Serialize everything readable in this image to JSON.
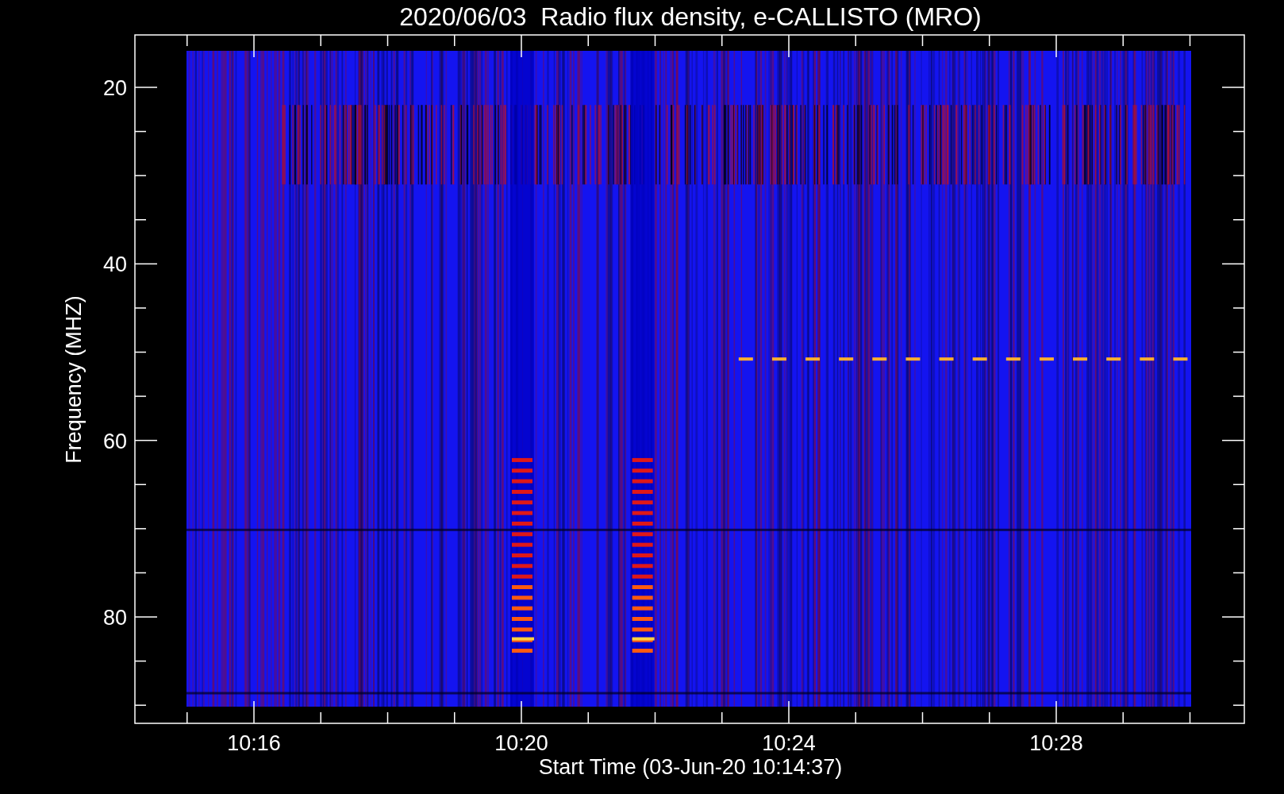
{
  "title": "2020/06/03  Radio flux density, e-CALLISTO (MRO)",
  "y_axis": {
    "label": "Frequency (MHZ)",
    "tick_labels": [
      "20",
      "40",
      "60",
      "80"
    ]
  },
  "x_axis": {
    "label": "Start Time (03-Jun-20 10:14:37)",
    "tick_labels": [
      "10:16",
      "10:20",
      "10:24",
      "10:28"
    ]
  }
}
